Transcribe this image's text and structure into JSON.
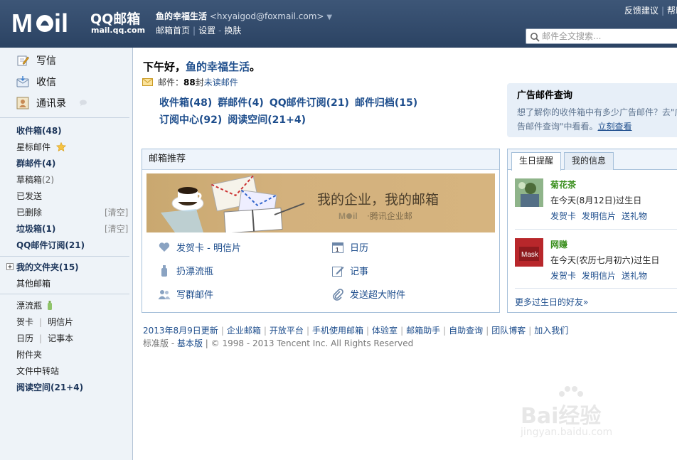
{
  "header": {
    "product_name": "QQ邮箱",
    "product_domain": "mail.qq.com",
    "user_nickname": "鱼的幸福生活",
    "user_email": "<hxyaigod@foxmail.com>",
    "dropdown_glyph": "▼",
    "links": [
      "邮箱首页",
      "设置",
      "换肤"
    ],
    "right_links": [
      "反馈建议",
      "帮助"
    ],
    "search_placeholder": "邮件全文搜索..."
  },
  "sidebar": {
    "write": "写信",
    "inbox": "收信",
    "contacts": "通讯录",
    "folders": [
      {
        "label": "收件箱(48)"
      },
      {
        "label": "星标邮件"
      },
      {
        "label": "群邮件(4)"
      },
      {
        "label": "草稿箱",
        "count": "(2)"
      },
      {
        "label": "已发送"
      },
      {
        "label": "已删除",
        "action": "[清空]"
      },
      {
        "label": "垃圾箱(1)",
        "action": "[清空]"
      },
      {
        "label": "QQ邮件订阅(21)"
      }
    ],
    "my_folders": "我的文件夹(15)",
    "other_mailbox": "其他邮箱",
    "apps": {
      "drift_bottle": "漂流瓶",
      "greeting_card": "贺卡",
      "postcard": "明信片",
      "calendar": "日历",
      "notebook": "记事本",
      "attachments": "附件夹",
      "file_transfer": "文件中转站",
      "reading_space": "阅读空间(21+4)"
    }
  },
  "main": {
    "greeting_prefix": "下午好，",
    "greeting_name": "鱼的幸福生活",
    "greeting_suffix": "。",
    "mail_label": "邮件：",
    "mail_count": "88",
    "mail_unit": " 封",
    "mail_unread": "未读邮件",
    "folder_links": [
      "收件箱(48)",
      "群邮件(4)",
      "QQ邮件订阅(21)",
      "邮件归档(15)",
      "订阅中心(92)",
      "阅读空间(21+4)"
    ],
    "ad_box": {
      "title": "广告邮件查询",
      "text": "想了解你的收件箱中有多少广告邮件？去\"广告邮件查询\"中看看。",
      "link": "立刻查看"
    },
    "recommend": {
      "title": "邮箱推荐",
      "banner_title": "我的企业，我的邮箱",
      "banner_sub": "腾讯企业邮",
      "items": [
        "发贺卡 - 明信片",
        "扔漂流瓶",
        "写群邮件",
        "日历",
        "记事",
        "发送超大附件"
      ]
    },
    "birthday": {
      "tabs": [
        "生日提醒",
        "我的信息"
      ],
      "friends": [
        {
          "name": "菊花茶",
          "desc": "在今天(8月12日)过生日"
        },
        {
          "name": "网赚",
          "desc": "在今天(农历七月初六)过生日"
        }
      ],
      "actions": [
        "发贺卡",
        "发明信片",
        "送礼物"
      ],
      "more": "更多过生日的好友»"
    }
  },
  "footer": {
    "links": [
      "2013年8月9日更新",
      "企业邮箱",
      "开放平台",
      "手机使用邮箱",
      "体验室",
      "邮箱助手",
      "自助查询",
      "团队博客",
      "加入我们"
    ],
    "edition_label": "标准版 - ",
    "edition_link": "基本版",
    "copyright": " | © 1998 - 2013 Tencent Inc. All Rights Reserved"
  },
  "watermark": {
    "brand": "Bai经验",
    "url": "jingyan.baidu.com"
  },
  "colors": {
    "header_bg": "#2f4868",
    "link_blue": "#1d4d8c",
    "sidebar_bg": "#eef3f8",
    "friend_name": "#3a8f1e"
  }
}
